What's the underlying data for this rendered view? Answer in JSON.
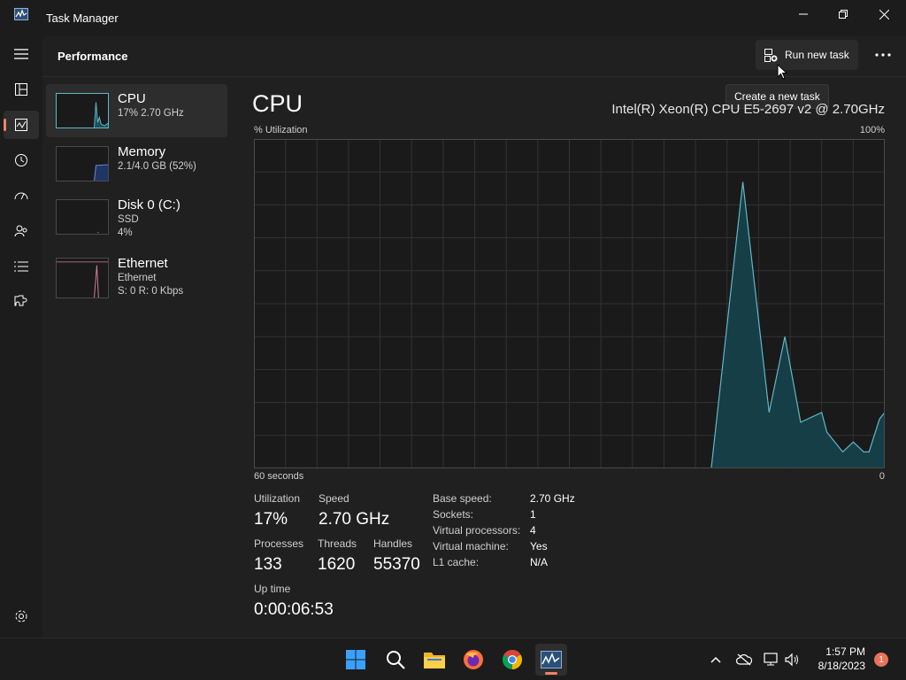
{
  "window": {
    "title": "Task Manager"
  },
  "header": {
    "page_title": "Performance",
    "run_task_label": "Run new task",
    "tooltip": "Create a new task"
  },
  "nav": {
    "items": [
      "menu-icon",
      "processes-icon",
      "performance-icon",
      "app-history-icon",
      "startup-apps-icon",
      "users-icon",
      "details-icon",
      "services-icon",
      "settings-icon"
    ],
    "active": "performance-icon"
  },
  "sidebar": {
    "cpu": {
      "name": "CPU",
      "sub": "17%  2.70 GHz",
      "fill": 0.17
    },
    "memory": {
      "name": "Memory",
      "sub": "2.1/4.0 GB (52%)",
      "fill": 0.52
    },
    "disk": {
      "name": "Disk 0 (C:)",
      "sub1": "SSD",
      "sub2": "4%",
      "fill": 0.04
    },
    "ethernet": {
      "name": "Ethernet",
      "sub1": "Ethernet",
      "sub2": "S: 0 R: 0 Kbps"
    }
  },
  "main": {
    "title": "CPU",
    "model": "Intel(R) Xeon(R) CPU E5-2697 v2 @ 2.70GHz",
    "util_label": "% Utilization",
    "max_label": "100%",
    "time_label": "60 seconds",
    "min_label": "0"
  },
  "chart_data": {
    "type": "area",
    "ylim": [
      0,
      100
    ],
    "xlim": [
      60,
      0
    ],
    "grid": true,
    "color": "#5fb8c8",
    "x": [
      60,
      16,
      13,
      11,
      9,
      6,
      4,
      3,
      1.5,
      0
    ],
    "values": [
      0,
      0,
      87,
      17,
      40,
      14,
      17,
      5,
      5,
      17
    ],
    "points": [
      [
        60,
        0
      ],
      [
        16.5,
        0
      ],
      [
        13.5,
        87
      ],
      [
        11,
        17
      ],
      [
        9.5,
        40
      ],
      [
        8,
        14
      ],
      [
        6,
        17
      ],
      [
        5.5,
        11
      ],
      [
        4,
        5
      ],
      [
        3,
        8
      ],
      [
        2,
        5
      ],
      [
        1.5,
        5
      ],
      [
        0.5,
        15
      ],
      [
        0,
        17
      ]
    ]
  },
  "stats": {
    "utilization": {
      "label": "Utilization",
      "value": "17%"
    },
    "speed": {
      "label": "Speed",
      "value": "2.70 GHz"
    },
    "processes": {
      "label": "Processes",
      "value": "133"
    },
    "threads": {
      "label": "Threads",
      "value": "1620"
    },
    "handles": {
      "label": "Handles",
      "value": "55370"
    },
    "uptime": {
      "label": "Up time",
      "value": "0:00:06:53"
    }
  },
  "specs": [
    {
      "label": "Base speed:",
      "value": "2.70 GHz"
    },
    {
      "label": "Sockets:",
      "value": "1"
    },
    {
      "label": "Virtual processors:",
      "value": "4"
    },
    {
      "label": "Virtual machine:",
      "value": "Yes"
    },
    {
      "label": "L1 cache:",
      "value": "N/A"
    }
  ],
  "taskbar": {
    "time": "1:57 PM",
    "date": "8/18/2023",
    "notifications": "1"
  },
  "colors": {
    "accent": "#f0826a",
    "cpu": "#5fb8c8",
    "memory": "#6f8fd8",
    "ethernet": "#d77aa0"
  }
}
